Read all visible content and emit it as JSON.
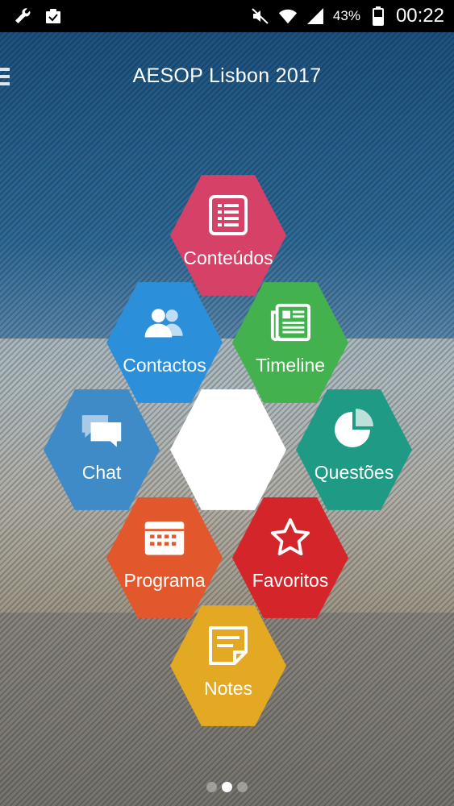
{
  "status_bar": {
    "battery": "43%",
    "time": "00:22",
    "icons_left": [
      "wrench-icon",
      "clipboard-check-icon"
    ],
    "icons_right": [
      "mute-icon",
      "wifi-icon",
      "signal-icon",
      "battery-icon"
    ]
  },
  "header": {
    "title": "AESOP Lisbon 2017",
    "menu_icon": "hamburger-icon"
  },
  "tiles": [
    {
      "id": "conteudos",
      "label": "Conteúdos",
      "icon": "list-document-icon",
      "color": "#d64167"
    },
    {
      "id": "contactos",
      "label": "Contactos",
      "icon": "people-icon",
      "color": "#2b8fd9"
    },
    {
      "id": "timeline",
      "label": "Timeline",
      "icon": "newspaper-icon",
      "color": "#44b14f"
    },
    {
      "id": "chat",
      "label": "Chat",
      "icon": "chat-bubbles-icon",
      "color": "#3f8bc7"
    },
    {
      "id": "questoes",
      "label": "Questões",
      "icon": "pie-chart-icon",
      "color": "#1f9a85"
    },
    {
      "id": "programa",
      "label": "Programa",
      "icon": "calendar-icon",
      "color": "#e2582c"
    },
    {
      "id": "favoritos",
      "label": "Favoritos",
      "icon": "star-icon",
      "color": "#d3252a"
    },
    {
      "id": "notes",
      "label": "Notes",
      "icon": "note-icon",
      "color": "#e3a923"
    }
  ],
  "pager": {
    "total": 3,
    "active": 2
  }
}
